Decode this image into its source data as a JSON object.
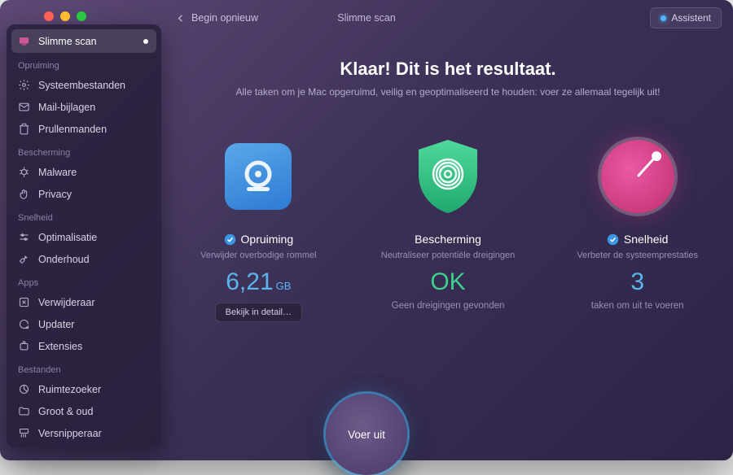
{
  "header": {
    "back_label": "Begin opnieuw",
    "title": "Slimme scan",
    "assistant_label": "Assistent"
  },
  "sidebar": {
    "active": {
      "label": "Slimme scan"
    },
    "sections": [
      {
        "header": "Opruiming",
        "items": [
          {
            "label": "Systeembestanden"
          },
          {
            "label": "Mail-bijlagen"
          },
          {
            "label": "Prullenmanden"
          }
        ]
      },
      {
        "header": "Bescherming",
        "items": [
          {
            "label": "Malware"
          },
          {
            "label": "Privacy"
          }
        ]
      },
      {
        "header": "Snelheid",
        "items": [
          {
            "label": "Optimalisatie"
          },
          {
            "label": "Onderhoud"
          }
        ]
      },
      {
        "header": "Apps",
        "items": [
          {
            "label": "Verwijderaar"
          },
          {
            "label": "Updater"
          },
          {
            "label": "Extensies"
          }
        ]
      },
      {
        "header": "Bestanden",
        "items": [
          {
            "label": "Ruimtezoeker"
          },
          {
            "label": "Groot & oud"
          },
          {
            "label": "Versnipperaar"
          }
        ]
      }
    ]
  },
  "main": {
    "headline": "Klaar! Dit is het resultaat.",
    "subline": "Alle taken om je Mac opgeruimd, veilig en geoptimaliseerd te houden: voer ze allemaal tegelijk uit!",
    "cards": {
      "cleanup": {
        "title": "Opruiming",
        "subtitle": "Verwijder overbodige rommel",
        "value": "6,21",
        "unit": "GB",
        "detail_label": "Bekijk in detail…"
      },
      "protection": {
        "title": "Bescherming",
        "subtitle": "Neutraliseer potentiële dreigingen",
        "value": "OK",
        "status": "Geen dreigingen gevonden"
      },
      "speed": {
        "title": "Snelheid",
        "subtitle": "Verbeter de systeemprestaties",
        "value": "3",
        "status": "taken om uit te voeren"
      }
    },
    "run_label": "Voer uit"
  }
}
